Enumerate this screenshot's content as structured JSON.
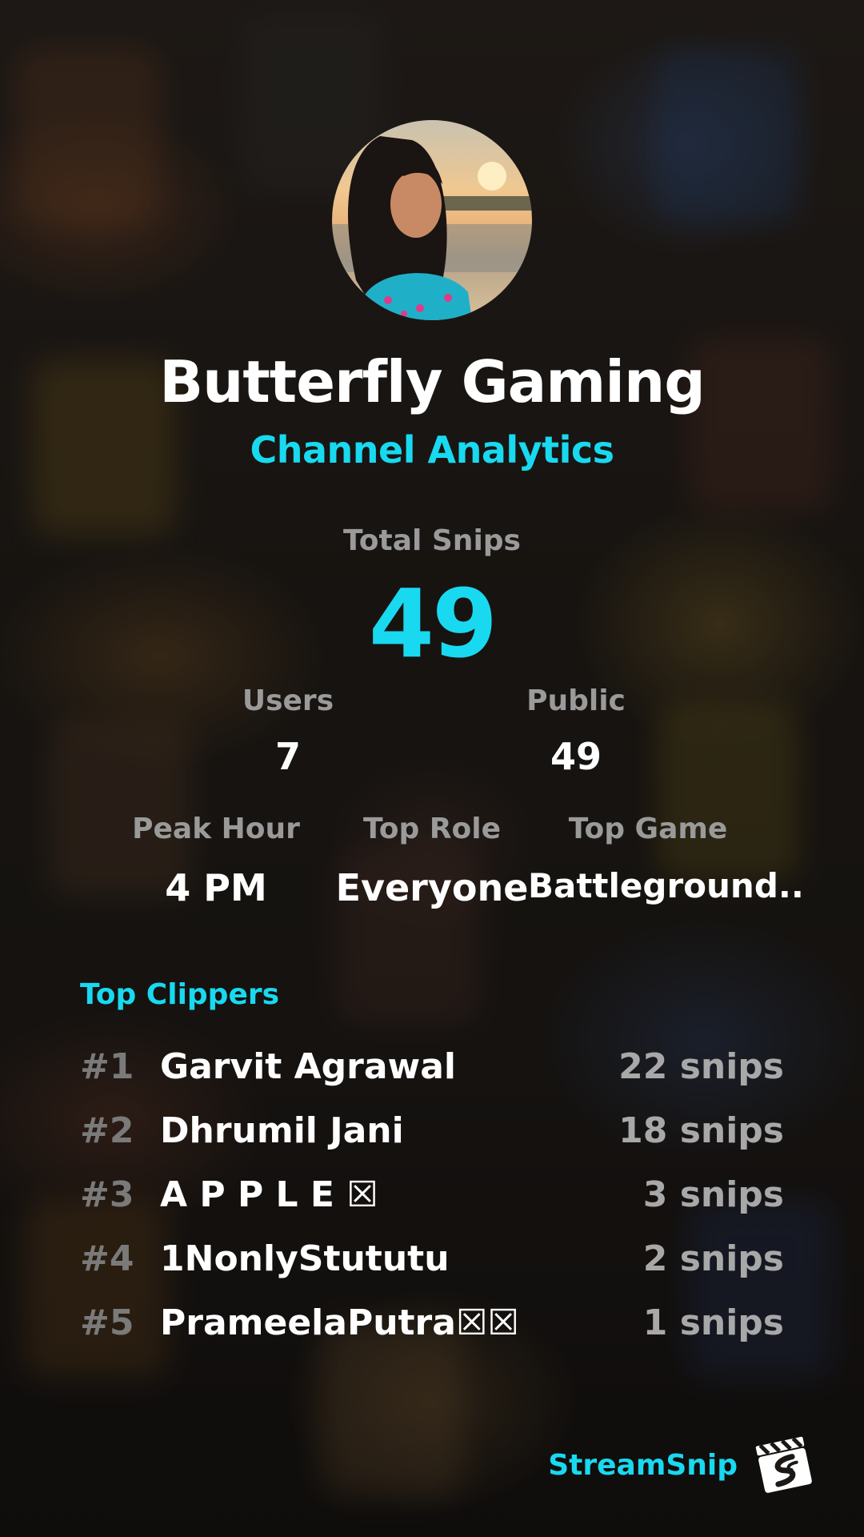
{
  "channel": {
    "name": "Butterfly Gaming",
    "subtitle": "Channel Analytics"
  },
  "totals": {
    "total_snips_label": "Total Snips",
    "total_snips_value": "49"
  },
  "stats_row1": [
    {
      "label": "Users",
      "value": "7"
    },
    {
      "label": "Public",
      "value": "49"
    }
  ],
  "stats_row2": [
    {
      "label": "Peak Hour",
      "value": "4 PM"
    },
    {
      "label": "Top Role",
      "value": "Everyone"
    },
    {
      "label": "Top Game",
      "value": "Battleground.."
    }
  ],
  "top_clippers": {
    "title": "Top Clippers",
    "rows": [
      {
        "rank": "#1",
        "name": "Garvit Agrawal",
        "count": "22 snips"
      },
      {
        "rank": "#2",
        "name": "Dhrumil Jani",
        "count": "18 snips"
      },
      {
        "rank": "#3",
        "name": "A P P L E ☒",
        "count": "3 snips"
      },
      {
        "rank": "#4",
        "name": "1NonlyStututu",
        "count": "2 snips"
      },
      {
        "rank": "#5",
        "name": "PrameelaPutra☒☒",
        "count": "1 snips"
      }
    ]
  },
  "brand": {
    "name": "StreamSnip",
    "logo_icon": "clapperboard-icon"
  },
  "colors": {
    "accent": "#18d9f0",
    "muted": "#9a9a9a",
    "text": "#ffffff"
  }
}
